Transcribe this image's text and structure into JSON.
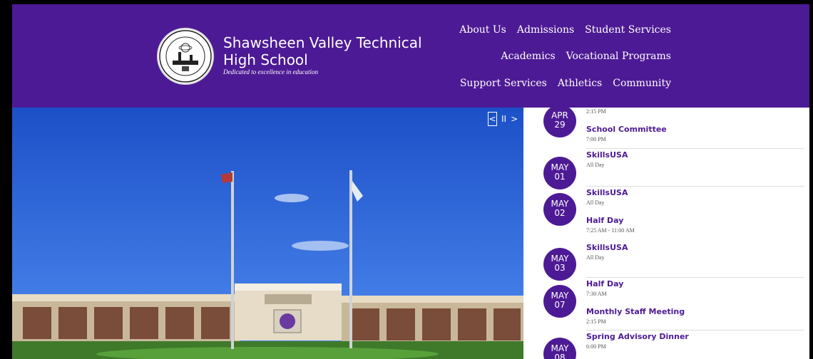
{
  "header": {
    "school_name": "Shawsheen Valley Technical High School",
    "tagline": "Dedicated to excellence in education",
    "logo_icon": "school-seal-icon",
    "bg_color": "#4d1a95"
  },
  "nav": {
    "row1": [
      "About Us",
      "Admissions",
      "Student Services"
    ],
    "row2": [
      "Academics",
      "Vocational Programs"
    ],
    "row3": [
      "Support Services",
      "Athletics",
      "Community"
    ]
  },
  "slider": {
    "prev_icon": "chevron-left-icon",
    "pause_icon": "pause-icon",
    "next_icon": "chevron-right-icon",
    "prev_glyph": "<",
    "pause_glyph": "II",
    "next_glyph": ">"
  },
  "events": [
    {
      "month": "APR",
      "day": "29",
      "items": [
        {
          "title": "",
          "time": "2:15 PM"
        },
        {
          "title": "School Committee",
          "time": "7:00 PM"
        }
      ]
    },
    {
      "month": "MAY",
      "day": "01",
      "items": [
        {
          "title": "SkillsUSA",
          "time": "All Day"
        }
      ]
    },
    {
      "month": "MAY",
      "day": "02",
      "items": [
        {
          "title": "SkillsUSA",
          "time": "All Day"
        },
        {
          "title": "Half Day",
          "time": "7:25 AM - 11:00 AM"
        }
      ]
    },
    {
      "month": "MAY",
      "day": "03",
      "items": [
        {
          "title": "SkillsUSA",
          "time": "All Day"
        }
      ]
    },
    {
      "month": "MAY",
      "day": "07",
      "items": [
        {
          "title": "Half Day",
          "time": "7:30 AM"
        },
        {
          "title": "Monthly Staff Meeting",
          "time": "2:15 PM"
        }
      ]
    },
    {
      "month": "MAY",
      "day": "08",
      "items": [
        {
          "title": "Spring Advisory Dinner",
          "time": "6:00 PM"
        }
      ]
    }
  ]
}
